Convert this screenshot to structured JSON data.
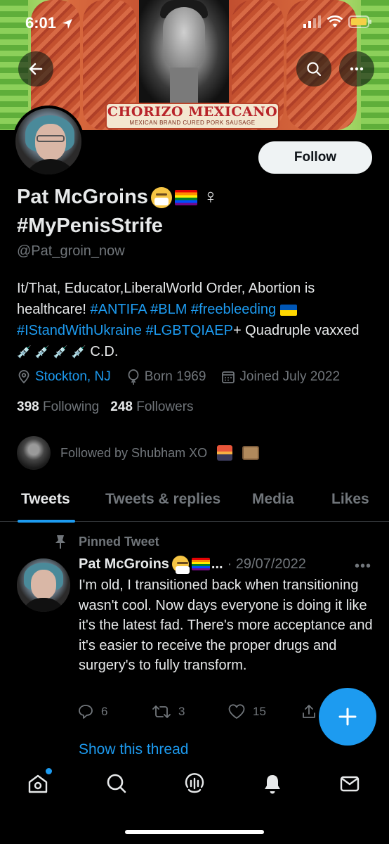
{
  "status_bar": {
    "time": "6:01"
  },
  "banner": {
    "brand_title": "CHORIZO MEXICANO",
    "brand_subtitle": "MEXICAN BRAND CURED PORK SAUSAGE"
  },
  "profile": {
    "follow_label": "Follow",
    "name": "Pat McGroins",
    "gender_symbol": "♀",
    "name_line2": "#MyPenisStrife",
    "handle": "@Pat_groin_now",
    "bio": {
      "part1": "It/That, Educator,LiberalWorld Order, Abortion is healthcare! ",
      "tag_antifa": "#ANTIFA",
      "tag_blm": "#BLM",
      "tag_freebleeding": "#freebleeding",
      "tag_ukraine": "#IStandWithUkraine",
      "tag_lgbt": "#LGBTQIAEP",
      "part2": "+ Quadruple vaxxed",
      "syringes": "💉 💉 💉 💉",
      "part3": " C.D."
    },
    "location": "Stockton, NJ",
    "born": "Born 1969",
    "joined": "Joined July 2022",
    "following_count": "398",
    "following_label": "Following",
    "followers_count": "248",
    "followers_label": "Followers",
    "followed_by": "Followed by Shubham XO"
  },
  "tabs": [
    "Tweets",
    "Tweets & replies",
    "Media",
    "Likes"
  ],
  "tweet": {
    "pinned_label": "Pinned Tweet",
    "name": "Pat McGroins",
    "ellipsis": "...",
    "date": "· 29/07/2022",
    "more": "•••",
    "text": "I'm old, I transitioned back when transitioning wasn't cool. Now days everyone is doing it like it's the latest fad. There's more acceptance and it's easier to receive the proper drugs and surgery's to fully transform.",
    "replies": "6",
    "retweets": "3",
    "likes": "15",
    "show_thread": "Show this thread"
  },
  "colors": {
    "accent": "#1d9bf0",
    "background": "#000000",
    "muted": "#71767b",
    "text": "#e7e9ea"
  },
  "icons": [
    "back-arrow-icon",
    "search-icon",
    "more-icon",
    "location-icon",
    "balloon-icon",
    "calendar-icon",
    "pin-icon",
    "reply-icon",
    "retweet-icon",
    "like-icon",
    "share-icon",
    "compose-plus-icon",
    "home-icon",
    "explore-icon",
    "spaces-icon",
    "notifications-icon",
    "messages-icon"
  ]
}
